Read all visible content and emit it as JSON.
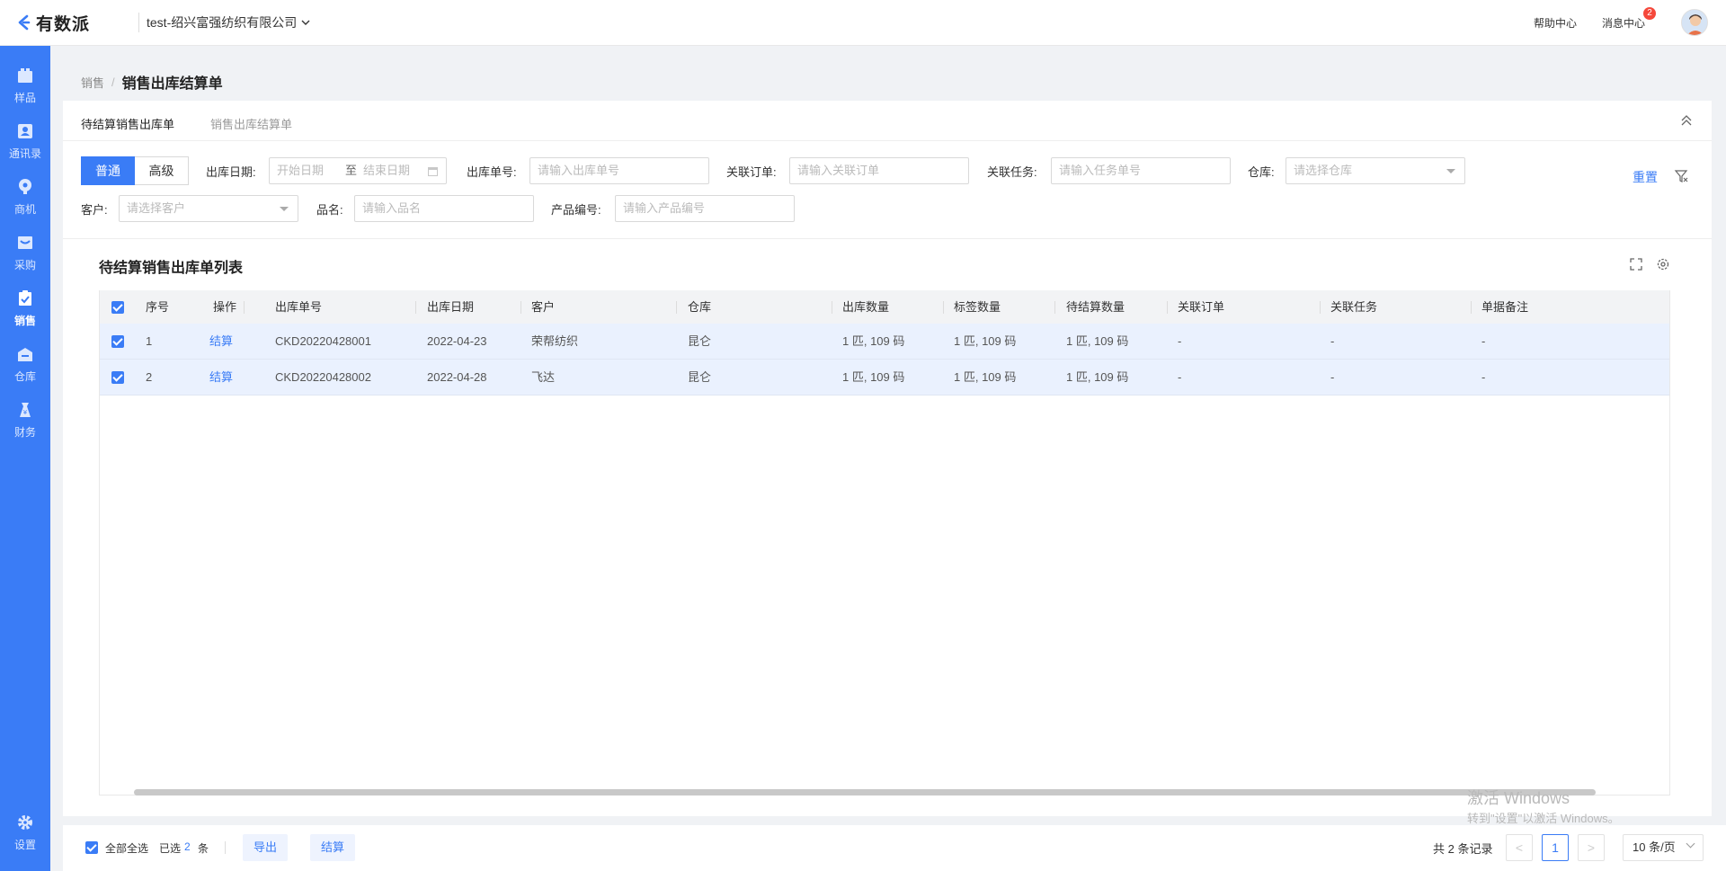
{
  "header": {
    "logo_text": "有数派",
    "company": "test-绍兴富强纺织有限公司",
    "help": "帮助中心",
    "messages": "消息中心",
    "message_count": "2"
  },
  "sidebar": {
    "items": [
      {
        "label": "样品",
        "icon": "sample-icon"
      },
      {
        "label": "通讯录",
        "icon": "contacts-icon"
      },
      {
        "label": "商机",
        "icon": "opportunity-icon"
      },
      {
        "label": "采购",
        "icon": "purchase-icon"
      },
      {
        "label": "销售",
        "icon": "sales-icon",
        "active": true
      },
      {
        "label": "仓库",
        "icon": "warehouse-icon"
      },
      {
        "label": "财务",
        "icon": "finance-icon"
      }
    ],
    "settings": "设置"
  },
  "breadcrumb": {
    "parent": "销售",
    "current": "销售出库结算单"
  },
  "tabs": [
    "待结算销售出库单",
    "销售出库结算单"
  ],
  "filters": {
    "mode_normal": "普通",
    "mode_advanced": "高级",
    "date_label": "出库日期:",
    "date_start": "开始日期",
    "date_to": "至",
    "date_end": "结束日期",
    "order_label": "出库单号:",
    "order_placeholder": "请输入出库单号",
    "related_order_label": "关联订单:",
    "related_order_placeholder": "请输入关联订单",
    "related_task_label": "关联任务:",
    "related_task_placeholder": "请输入任务单号",
    "warehouse_label": "仓库:",
    "warehouse_placeholder": "请选择仓库",
    "customer_label": "客户:",
    "customer_placeholder": "请选择客户",
    "product_label": "品名:",
    "product_placeholder": "请输入品名",
    "code_label": "产品编号:",
    "code_placeholder": "请输入产品编号",
    "reset": "重置"
  },
  "list": {
    "title": "待结算销售出库单列表",
    "columns": [
      "序号",
      "操作",
      "出库单号",
      "出库日期",
      "客户",
      "仓库",
      "出库数量",
      "标签数量",
      "待结算数量",
      "关联订单",
      "关联任务",
      "单据备注"
    ],
    "rows": [
      {
        "no": "1",
        "action": "结算",
        "order": "CKD20220428001",
        "date": "2022-04-23",
        "customer": "荣帮纺织",
        "warehouse": "昆仑",
        "qty": "1 匹, 109 码",
        "tag_qty": "1 匹, 109 码",
        "pending_qty": "1 匹, 109 码",
        "related_order": "-",
        "related_task": "-",
        "remark": "-"
      },
      {
        "no": "2",
        "action": "结算",
        "order": "CKD20220428002",
        "date": "2022-04-28",
        "customer": "飞达",
        "warehouse": "昆仑",
        "qty": "1 匹, 109 码",
        "tag_qty": "1 匹, 109 码",
        "pending_qty": "1 匹, 109 码",
        "related_order": "-",
        "related_task": "-",
        "remark": "-"
      }
    ]
  },
  "footer": {
    "select_all": "全部全选",
    "selected_prefix": "已选",
    "selected_count": "2",
    "selected_suffix": "条",
    "export": "导出",
    "settle": "结算",
    "total": "共 2 条记录",
    "prev": "<",
    "page": "1",
    "next": ">",
    "page_size": "10 条/页"
  },
  "watermark": {
    "line1": "激活 Windows",
    "line2": "转到\"设置\"以激活 Windows。"
  },
  "colors": {
    "primary": "#3a7cf6",
    "badge": "#f5483b",
    "row_selected": "#eaf1fe"
  }
}
